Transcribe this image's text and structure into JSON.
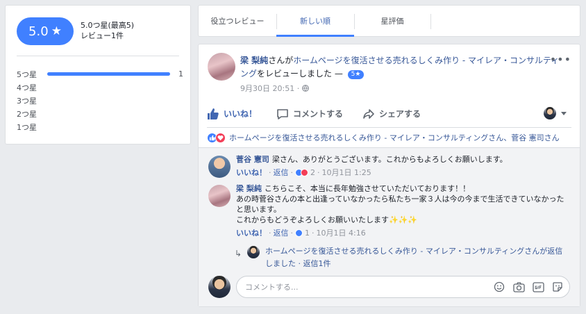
{
  "summary": {
    "score": "5.0",
    "score_star": "★",
    "score_label": "5.0つ星(最高5)",
    "review_count": "レビュー1件",
    "rows": [
      {
        "label": "5つ星",
        "count": "1",
        "fraction": 1.0
      },
      {
        "label": "4つ星",
        "count": "",
        "fraction": 0
      },
      {
        "label": "3つ星",
        "count": "",
        "fraction": 0
      },
      {
        "label": "2つ星",
        "count": "",
        "fraction": 0
      },
      {
        "label": "1つ星",
        "count": "",
        "fraction": 0
      }
    ]
  },
  "tabs": {
    "helpful": "役立つレビュー",
    "newest": "新しい順",
    "stars": "星評価",
    "active": "newest"
  },
  "post": {
    "author": "梁 梨純",
    "suffix": "さんが",
    "page_name": "ホームページを復活させる売れるしくみ作り - マイレア・コンサルティング",
    "review_text": "をレビューしました — ",
    "rating_badge": "5★",
    "time": "9月30日 20:51 ·",
    "more": "•••",
    "like_label": "いいね！",
    "comment_label": "コメントする",
    "share_label": "シェアする",
    "likes_text": "ホームページを復活させる売れるしくみ作り - マイレア・コンサルティングさん、菅谷 憲司さん"
  },
  "comments": [
    {
      "author": "菅谷 憲司",
      "text": "梁さん、ありがとうございます。これからもよろしくお願いします。",
      "like": "いいね！",
      "reply": "返信",
      "reactions": "2",
      "date": "10月1日 1:25"
    },
    {
      "author": "梁 梨純",
      "text": "こちらこそ、本当に長年勉強させていただいております！！",
      "text2": "あの時菅谷さんの本と出逢っていなかったら私たち一家３人は今の今まで生活できていなかったと思います。",
      "text3": "これからもどうぞよろしくお願いいたします",
      "sparkles": "✨✨✨",
      "like": "いいね！",
      "reply": "返信",
      "reactions": "1",
      "date": "10月1日 4:16"
    }
  ],
  "reply_summary": {
    "text": "ホームページを復活させる売れるしくみ作り - マイレア・コンサルティングさんが返信しました · 返信1件"
  },
  "compose": {
    "placeholder": "コメントする..."
  }
}
